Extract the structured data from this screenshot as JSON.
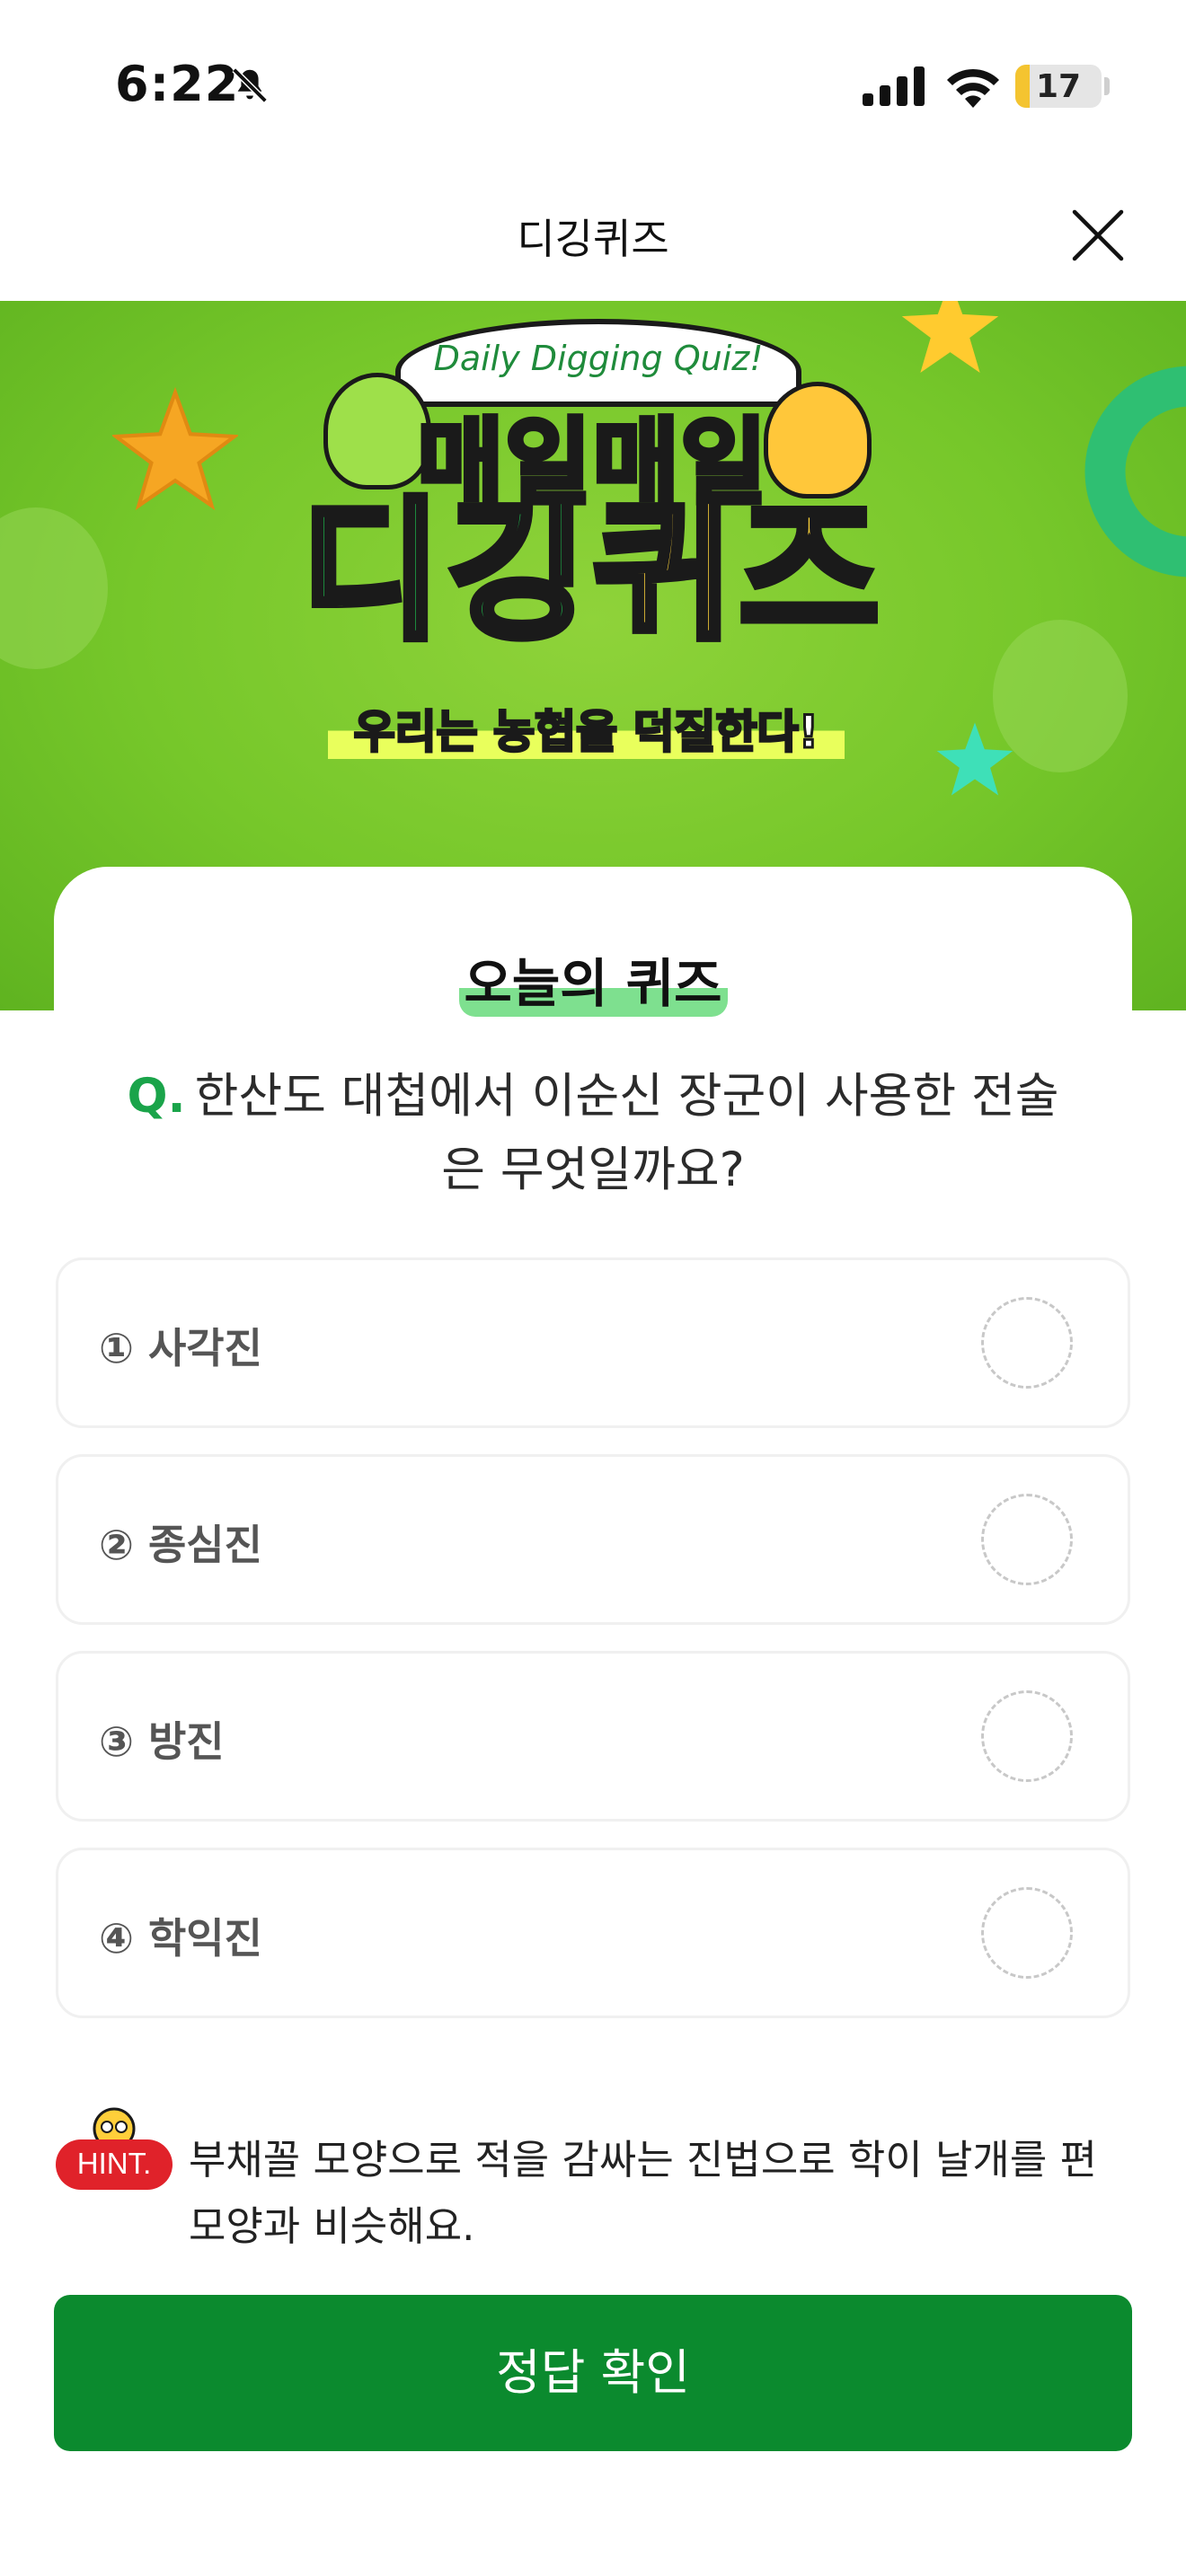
{
  "status_bar": {
    "time": "6:22",
    "battery": "17",
    "battery_level": 0.17
  },
  "nav": {
    "title": "디깅퀴즈"
  },
  "banner": {
    "ribbon": "Daily Digging Quiz!",
    "headline_line1": "매일매일",
    "headline_green": "디깅",
    "headline_yellow": "퀴즈",
    "slogan": "우리는 농협을 덕질한다!"
  },
  "quiz": {
    "section_title": "오늘의 퀴즈",
    "q_mark": "Q.",
    "question": "한산도 대첩에서 이순신 장군이 사용한 전술은 무엇일까요?",
    "options": [
      {
        "label": "① 사각진"
      },
      {
        "label": "② 종심진"
      },
      {
        "label": "③ 방진"
      },
      {
        "label": "④ 학익진"
      }
    ]
  },
  "hint": {
    "badge": "HINT.",
    "text": "부채꼴 모양으로 적을 감싸는 진법으로 학이 날개를 편 모양과 비슷해요."
  },
  "submit_label": "정답 확인",
  "colors": {
    "brand_green": "#0b8a2e",
    "accent_green": "#1aa44a",
    "hint_red": "#e0222a"
  }
}
